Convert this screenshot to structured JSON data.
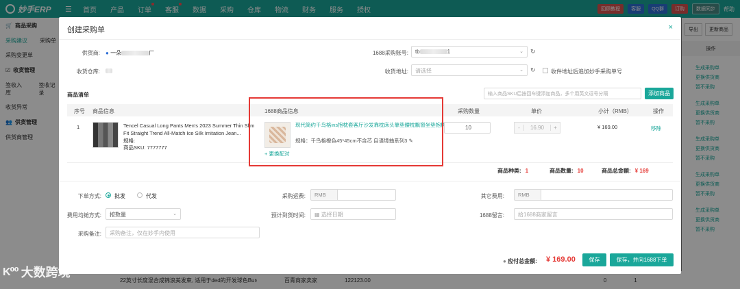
{
  "nav": {
    "logo": "妙手ERP",
    "items": [
      "首页",
      "产品",
      "订单",
      "客服",
      "数据",
      "采购",
      "仓库",
      "物流",
      "财务",
      "服务",
      "授权"
    ],
    "right": [
      "回顾教程",
      "客服",
      "QQ群",
      "订购",
      "数据同步",
      "帮助"
    ]
  },
  "sidebar": {
    "sec1": "商品采购",
    "row1": [
      "采购建议",
      "采购单"
    ],
    "row2": [
      "采购变更单"
    ],
    "sec2": "收货管理",
    "row3": [
      "签收入库",
      "签收记录"
    ],
    "row4": [
      "收货异常"
    ],
    "sec3": "供货管理",
    "row5": [
      "供货商管理"
    ]
  },
  "right_panel": {
    "btns": [
      "导出",
      "更新商品"
    ],
    "head": "操作",
    "links": [
      "生成采购单",
      "更换供货商",
      "暂不采购",
      "生成采购单",
      "更换供货商",
      "暂不采购",
      "生成采购单",
      "更换供货商",
      "暂不采购",
      "生成采购单",
      "更换供货商",
      "暂不采购",
      "生成采购单",
      "更换供货商",
      "暂不采购"
    ]
  },
  "bg_row": {
    "title": "22英寸长度混合成锦浪美发束, 适用于ded的开发球色Burdy",
    "supplier": "百青商家卖家",
    "code": "122123.00",
    "qty": "0",
    "num": "1"
  },
  "watermark": "大数跨境",
  "modal": {
    "title": "创建采购单",
    "close": "×",
    "supplier_label": "供货商:",
    "supplier_value": "一朵",
    "supplier_suffix": "厂",
    "account_label": "1688采购账号:",
    "account_value": "tb",
    "account_suffix": "1",
    "warehouse_label": "收货仓库:",
    "warehouse_value": "",
    "address_label": "收货地址:",
    "address_placeholder": "请选择",
    "address_check": "收件地址后追加妙手采购单号",
    "goods_title": "商品清单",
    "goods_search_placeholder": "输入商品SKU后按回车键添加商品，多个用英文逗号分隔",
    "add_goods": "添加商品",
    "headers": {
      "no": "序号",
      "info": "商品信息",
      "info1688": "1688商品信息",
      "qty": "采购数量",
      "price": "单价",
      "subtotal": "小计（RMB）",
      "op": "操作"
    },
    "row": {
      "no": "1",
      "title": "Tencel Casual Long Pants Men's 2023 Summer Thin Slim Fit Straight Trend All-Match Ice Silk Imitation Jean...",
      "spec_label": "规格:",
      "sku_label": "商品SKU:",
      "sku": "7777777",
      "t1688": "现代简约千鸟格ins抱枕套客厅沙发靠枕床头靠垫腰枕飘窗坐垫抱枕",
      "spec1688": "规格：千鸟格橙色45*45cm不含芯 自语境抽系列3",
      "rematch": "+ 更换配对",
      "qty": "10",
      "minus": "-",
      "price": "16.90",
      "plus": "+",
      "subtotal": "¥ 169.00",
      "remove": "移除"
    },
    "summary": {
      "kinds_label": "商品种类:",
      "kinds": "1",
      "count_label": "商品数量:",
      "count": "10",
      "amount_label": "商品总金额:",
      "amount": "¥ 169"
    },
    "order_type_label": "下单方式:",
    "order_type_1": "批发",
    "order_type_2": "代发",
    "freight_label": "采购运费:",
    "rmb": "RMB",
    "other_fee_label": "其它费用:",
    "split_label": "费用均摊方式:",
    "split_value": "按数量",
    "eta_label": "预计到货时间:",
    "eta_placeholder": "选择日期",
    "msg1688_label": "1688留言:",
    "msg1688_placeholder": "给1688商家留言",
    "remark_label": "采购备注:",
    "remark_placeholder": "采购备注，仅在妙手内使用",
    "total_label": "应付总金额:",
    "total_value": "¥ 169.00",
    "save": "保存",
    "save_order": "保存，并向1688下单"
  }
}
